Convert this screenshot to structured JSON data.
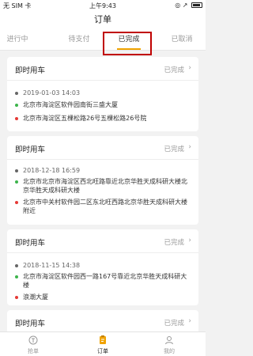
{
  "status_bar": {
    "carrier": "无 SIM 卡",
    "wifi_icon": "wifi-icon",
    "time": "上午9:43",
    "right_icons": "◎ ↗ 🔋"
  },
  "nav": {
    "title": "订单"
  },
  "tabs": [
    {
      "label": "进行中"
    },
    {
      "label": "待支付"
    },
    {
      "label": "已完成"
    },
    {
      "label": "已取消"
    }
  ],
  "cards": [
    {
      "title": "即时用车",
      "status": "已完成",
      "time": "2019-01-03 14:03",
      "from": "北京市海淀区软件园南街三盛大厦",
      "to": "北京市海淀区五棵松路26号五棵松路26号院"
    },
    {
      "title": "即时用车",
      "status": "已完成",
      "time": "2018-12-18 16:59",
      "from": "北京市北京市海淀区西北旺路靠近北京华胜天成科研大楼北京华胜天成科研大楼",
      "to": "北京市中关村软件园二区东北旺西路北京华胜天成科研大楼附近"
    },
    {
      "title": "即时用车",
      "status": "已完成",
      "time": "2018-11-15 14:38",
      "from": "北京市海淀区软件园西一路167号靠近北京华胜天成科研大楼",
      "to": "浪潮大厦"
    },
    {
      "title": "即时用车",
      "status": "已完成"
    }
  ],
  "tabbar": [
    {
      "label": "抢单",
      "icon": "grab-order-icon"
    },
    {
      "label": "订单",
      "icon": "order-icon"
    },
    {
      "label": "我的",
      "icon": "profile-icon"
    }
  ],
  "colors": {
    "accent": "#f0a300",
    "start_dot": "#3cb44b",
    "end_dot": "#e53935",
    "time_dot": "#666666",
    "highlight": "#c00000"
  }
}
